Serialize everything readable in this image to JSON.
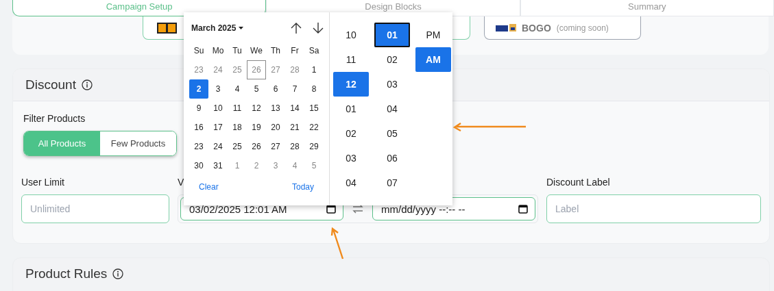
{
  "tabs": [
    {
      "label": "Campaign Setup",
      "selected": true
    },
    {
      "label": "Design Blocks",
      "selected": false
    },
    {
      "label": "Summary",
      "selected": false
    }
  ],
  "discount_types": [
    {
      "selected": true
    },
    {
      "label": "BOGO",
      "note": "(coming soon)",
      "selected": false
    }
  ],
  "discount": {
    "title": "Discount",
    "filter_label": "Filter Products",
    "filter_options": [
      {
        "label": "All Products",
        "selected": true
      },
      {
        "label": "Few Products",
        "selected": false
      }
    ],
    "user_limit": {
      "label": "User Limit",
      "placeholder": "Unlimited"
    },
    "validity": {
      "label": "V",
      "start_value": "03/02/2025 12:01 AM",
      "end_value": "mm/dd/yyyy --:-- --"
    },
    "discount_label": {
      "label": "Discount Label",
      "placeholder": "Label"
    }
  },
  "product_rules": {
    "title": "Product Rules"
  },
  "picker": {
    "month": "March 2025",
    "weekdays": [
      "Su",
      "Mo",
      "Tu",
      "We",
      "Th",
      "Fr",
      "Sa"
    ],
    "days": [
      {
        "d": "23",
        "muted": true,
        "selected": false,
        "today": false
      },
      {
        "d": "24",
        "muted": true,
        "selected": false,
        "today": false
      },
      {
        "d": "25",
        "muted": true,
        "selected": false,
        "today": false
      },
      {
        "d": "26",
        "muted": true,
        "selected": false,
        "today": true
      },
      {
        "d": "27",
        "muted": true,
        "selected": false,
        "today": false
      },
      {
        "d": "28",
        "muted": true,
        "selected": false,
        "today": false
      },
      {
        "d": "1",
        "muted": false,
        "selected": false,
        "today": false
      },
      {
        "d": "2",
        "muted": false,
        "selected": true,
        "today": false
      },
      {
        "d": "3",
        "muted": false,
        "selected": false,
        "today": false
      },
      {
        "d": "4",
        "muted": false,
        "selected": false,
        "today": false
      },
      {
        "d": "5",
        "muted": false,
        "selected": false,
        "today": false
      },
      {
        "d": "6",
        "muted": false,
        "selected": false,
        "today": false
      },
      {
        "d": "7",
        "muted": false,
        "selected": false,
        "today": false
      },
      {
        "d": "8",
        "muted": false,
        "selected": false,
        "today": false
      },
      {
        "d": "9",
        "muted": false,
        "selected": false,
        "today": false
      },
      {
        "d": "10",
        "muted": false,
        "selected": false,
        "today": false
      },
      {
        "d": "11",
        "muted": false,
        "selected": false,
        "today": false
      },
      {
        "d": "12",
        "muted": false,
        "selected": false,
        "today": false
      },
      {
        "d": "13",
        "muted": false,
        "selected": false,
        "today": false
      },
      {
        "d": "14",
        "muted": false,
        "selected": false,
        "today": false
      },
      {
        "d": "15",
        "muted": false,
        "selected": false,
        "today": false
      },
      {
        "d": "16",
        "muted": false,
        "selected": false,
        "today": false
      },
      {
        "d": "17",
        "muted": false,
        "selected": false,
        "today": false
      },
      {
        "d": "18",
        "muted": false,
        "selected": false,
        "today": false
      },
      {
        "d": "19",
        "muted": false,
        "selected": false,
        "today": false
      },
      {
        "d": "20",
        "muted": false,
        "selected": false,
        "today": false
      },
      {
        "d": "21",
        "muted": false,
        "selected": false,
        "today": false
      },
      {
        "d": "22",
        "muted": false,
        "selected": false,
        "today": false
      },
      {
        "d": "23",
        "muted": false,
        "selected": false,
        "today": false
      },
      {
        "d": "24",
        "muted": false,
        "selected": false,
        "today": false
      },
      {
        "d": "25",
        "muted": false,
        "selected": false,
        "today": false
      },
      {
        "d": "26",
        "muted": false,
        "selected": false,
        "today": false
      },
      {
        "d": "27",
        "muted": false,
        "selected": false,
        "today": false
      },
      {
        "d": "28",
        "muted": false,
        "selected": false,
        "today": false
      },
      {
        "d": "29",
        "muted": false,
        "selected": false,
        "today": false
      },
      {
        "d": "30",
        "muted": false,
        "selected": false,
        "today": false
      },
      {
        "d": "31",
        "muted": false,
        "selected": false,
        "today": false
      },
      {
        "d": "1",
        "muted": true,
        "selected": false,
        "today": false
      },
      {
        "d": "2",
        "muted": true,
        "selected": false,
        "today": false
      },
      {
        "d": "3",
        "muted": true,
        "selected": false,
        "today": false
      },
      {
        "d": "4",
        "muted": true,
        "selected": false,
        "today": false
      },
      {
        "d": "5",
        "muted": true,
        "selected": false,
        "today": false
      }
    ],
    "clear": "Clear",
    "today": "Today",
    "hours": [
      {
        "v": "10",
        "selected": false
      },
      {
        "v": "11",
        "selected": false
      },
      {
        "v": "12",
        "selected": true
      },
      {
        "v": "01",
        "selected": false
      },
      {
        "v": "02",
        "selected": false
      },
      {
        "v": "03",
        "selected": false
      },
      {
        "v": "04",
        "selected": false
      }
    ],
    "minutes": [
      {
        "v": "01",
        "selected": true
      },
      {
        "v": "02",
        "selected": false
      },
      {
        "v": "03",
        "selected": false
      },
      {
        "v": "04",
        "selected": false
      },
      {
        "v": "05",
        "selected": false
      },
      {
        "v": "06",
        "selected": false
      },
      {
        "v": "07",
        "selected": false
      }
    ],
    "meridiem": [
      {
        "v": "PM",
        "selected": false
      },
      {
        "v": "AM",
        "selected": true
      }
    ]
  }
}
